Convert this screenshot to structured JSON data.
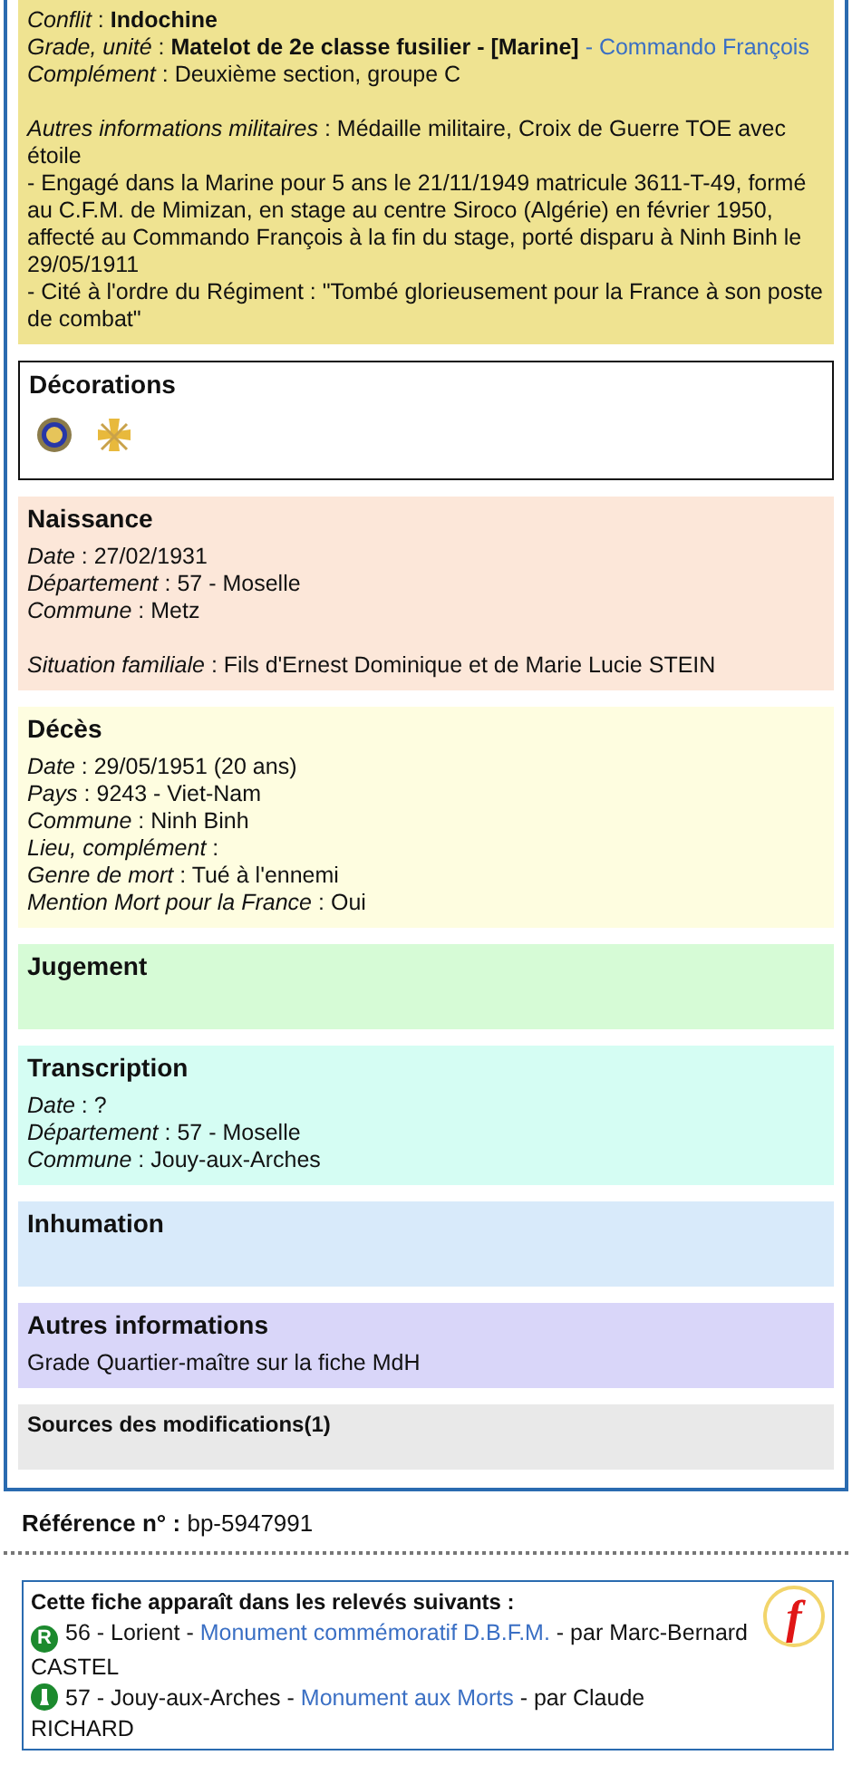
{
  "separator": ":",
  "sections": [
    {
      "kind": "fields",
      "color": "#efe391",
      "lines": [
        {
          "label": "Conflit",
          "value": "Indochine",
          "bold": true
        },
        {
          "label": "Grade, unité",
          "value": "Matelot de 2e classe fusilier - [Marine]",
          "bold": true,
          "link": "- Commando François"
        },
        {
          "label": "Complément",
          "value": "Deuxième section, groupe C"
        },
        {
          "label": "Autres informations militaires",
          "value": "Médaille militaire, Croix de Guerre TOE avec étoile",
          "gap_before": true
        },
        {
          "value": "- Engagé dans la Marine pour 5 ans le 21/11/1949 matricule 3611-T-49, formé au C.F.M. de Mimizan, en stage au centre Siroco (Algérie) en février 1950, affecté au Commando François à la fin du stage, porté disparu à Ninh Binh le 29/05/1911"
        },
        {
          "value": "- Cité à l'ordre du Régiment : \"Tombé glorieusement pour la France à son poste de combat\""
        }
      ]
    },
    {
      "kind": "decorations",
      "title": "Décorations",
      "medals": [
        {
          "kind": "medal"
        },
        {
          "kind": "cross"
        }
      ]
    },
    {
      "kind": "fields",
      "title": "Naissance",
      "color": "#fce7d9",
      "lines": [
        {
          "label": "Date",
          "value": "27/02/1931"
        },
        {
          "label": "Département",
          "value": "57 - Moselle"
        },
        {
          "label": "Commune",
          "value": "Metz"
        },
        {
          "label": "Situation familiale",
          "value": "Fils d'Ernest Dominique et de Marie Lucie STEIN",
          "gap_before": true
        }
      ]
    },
    {
      "kind": "fields",
      "title": "Décès",
      "color": "#fefde0",
      "lines": [
        {
          "label": "Date",
          "value": "29/05/1951  (20 ans)"
        },
        {
          "label": "Pays",
          "value": "9243 - Viet-Nam"
        },
        {
          "label": "Commune",
          "value": "Ninh Binh"
        },
        {
          "label": "Lieu, complément"
        },
        {
          "label": "Genre de mort",
          "value": "Tué à l'ennemi"
        },
        {
          "label": "Mention Mort pour la France",
          "value": "Oui"
        }
      ]
    },
    {
      "kind": "fields",
      "title": "Jugement",
      "color": "#d6fbd6"
    },
    {
      "kind": "fields",
      "title": "Transcription",
      "color": "#d5fdf3",
      "lines": [
        {
          "label": "Date",
          "value": "?"
        },
        {
          "label": "Département",
          "value": "57 - Moselle"
        },
        {
          "label": "Commune",
          "value": "Jouy-aux-Arches"
        }
      ]
    },
    {
      "kind": "fields",
      "title": "Inhumation",
      "color": "#d8eafa"
    },
    {
      "kind": "fields",
      "title": "Autres informations",
      "color": "#d9d6f9",
      "lines": [
        {
          "value": "Grade Quartier-maître sur la fiche MdH"
        }
      ]
    },
    {
      "kind": "sources",
      "title": "Sources des modifications(1)",
      "color": "#e9e9e9"
    }
  ],
  "reference": {
    "label": "Référence n°",
    "value": "bp-5947991"
  },
  "releves": {
    "title": "Cette fiche apparaît dans les relevés suivants :",
    "badge": "f",
    "entries": [
      {
        "kind": "letter",
        "icon": "R",
        "prefix": "56 - Lorient - ",
        "link": "Monument commémoratif D.B.F.M.",
        "suffix": " - par Marc-Bernard CASTEL"
      },
      {
        "kind": "monument",
        "prefix": "57 - Jouy-aux-Arches - ",
        "link": "Monument aux Morts",
        "suffix": " - par Claude RICHARD"
      }
    ]
  }
}
